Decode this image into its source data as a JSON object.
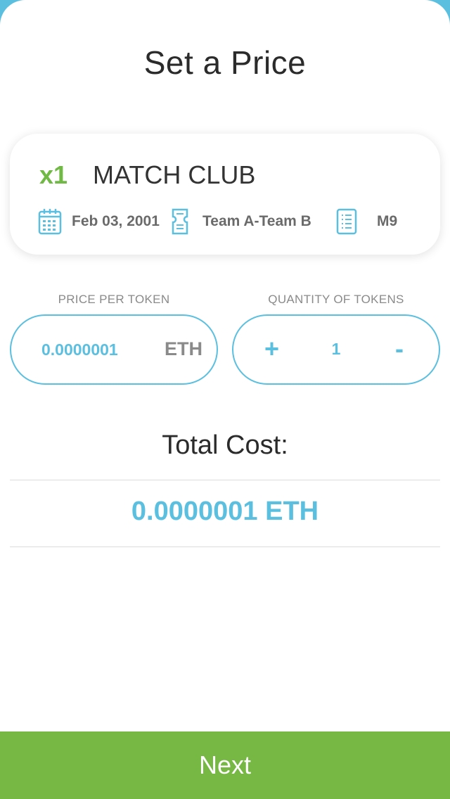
{
  "page": {
    "title": "Set a Price"
  },
  "ticket": {
    "quantity": "x1",
    "event_name": "MATCH CLUB",
    "date": "Feb 03, 2001",
    "teams": "Team A-Team B",
    "match_code": "M9",
    "icons": [
      "calendar-icon",
      "ticket-icon",
      "document-icon"
    ]
  },
  "price": {
    "label": "PRICE PER TOKEN",
    "value": "0.0000001",
    "unit": "ETH"
  },
  "quantity": {
    "label": "QUANTITY OF TOKENS",
    "plus": "+",
    "value": "1",
    "minus": "-"
  },
  "total": {
    "label": "Total Cost:",
    "value": "0.0000001 ETH"
  },
  "footer": {
    "next_label": "Next"
  },
  "colors": {
    "accent_blue": "#5bbfe0",
    "accent_green": "#76b843",
    "quantity_green": "#6fb944"
  }
}
